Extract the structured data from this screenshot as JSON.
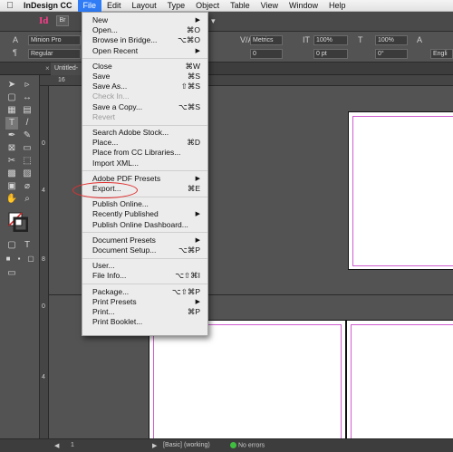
{
  "menubar": {
    "apple": "",
    "app": "InDesign CC",
    "items": [
      "File",
      "Edit",
      "Layout",
      "Type",
      "Object",
      "Table",
      "View",
      "Window",
      "Help"
    ]
  },
  "appbar": {
    "logo": "Id",
    "bridge": "Br"
  },
  "control": {
    "font_name": "Minion Pro",
    "font_style": "Regular",
    "kerning": "Metrics",
    "scale_h": "100%",
    "scale_v": "100%",
    "baseline": "0 pt",
    "skew": "0°",
    "tracking": "0",
    "language": "Engli"
  },
  "tabbar": {
    "doc_title": "Untitled-"
  },
  "ruler": {
    "top": [
      "16"
    ],
    "left": [
      "0",
      "4",
      "8",
      "0",
      "4"
    ]
  },
  "status": {
    "page": "1",
    "style": "[Basic] (working)",
    "errors": "No errors"
  },
  "file_menu": {
    "groups": [
      [
        {
          "label": "New",
          "shortcut": "",
          "submenu": true
        },
        {
          "label": "Open...",
          "shortcut": "⌘O"
        },
        {
          "label": "Browse in Bridge...",
          "shortcut": "⌥⌘O"
        },
        {
          "label": "Open Recent",
          "shortcut": "",
          "submenu": true
        }
      ],
      [
        {
          "label": "Close",
          "shortcut": "⌘W"
        },
        {
          "label": "Save",
          "shortcut": "⌘S"
        },
        {
          "label": "Save As...",
          "shortcut": "⇧⌘S"
        },
        {
          "label": "Check In...",
          "shortcut": "",
          "disabled": true
        },
        {
          "label": "Save a Copy...",
          "shortcut": "⌥⌘S"
        },
        {
          "label": "Revert",
          "shortcut": "",
          "disabled": true
        }
      ],
      [
        {
          "label": "Search Adobe Stock...",
          "shortcut": ""
        },
        {
          "label": "Place...",
          "shortcut": "⌘D"
        },
        {
          "label": "Place from CC Libraries...",
          "shortcut": ""
        },
        {
          "label": "Import XML...",
          "shortcut": ""
        }
      ],
      [
        {
          "label": "Adobe PDF Presets",
          "shortcut": "",
          "submenu": true
        },
        {
          "label": "Export...",
          "shortcut": "⌘E"
        }
      ],
      [
        {
          "label": "Publish Online...",
          "shortcut": ""
        },
        {
          "label": "Recently Published",
          "shortcut": "",
          "submenu": true
        },
        {
          "label": "Publish Online Dashboard...",
          "shortcut": ""
        }
      ],
      [
        {
          "label": "Document Presets",
          "shortcut": "",
          "submenu": true
        },
        {
          "label": "Document Setup...",
          "shortcut": "⌥⌘P"
        }
      ],
      [
        {
          "label": "User...",
          "shortcut": ""
        },
        {
          "label": "File Info...",
          "shortcut": "⌥⇧⌘I"
        }
      ],
      [
        {
          "label": "Package...",
          "shortcut": "⌥⇧⌘P"
        },
        {
          "label": "Print Presets",
          "shortcut": "",
          "submenu": true
        },
        {
          "label": "Print...",
          "shortcut": "⌘P"
        },
        {
          "label": "Print Booklet...",
          "shortcut": ""
        }
      ]
    ]
  },
  "colors": {
    "accent": "#2f7cf6",
    "annotation": "#e23030",
    "margin_guide": "#d05ed0",
    "indesign_pink": "#ff3d8b"
  }
}
